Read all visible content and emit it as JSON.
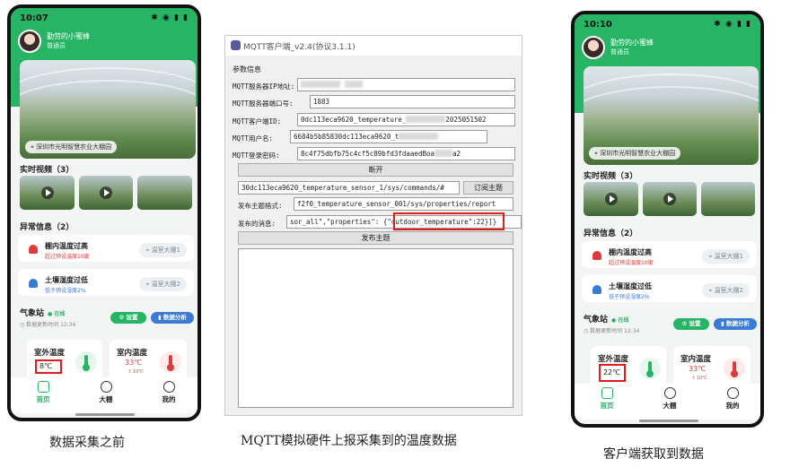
{
  "left_phone": {
    "status": {
      "time": "10:07"
    },
    "user": {
      "name": "勤劳的小蜜蜂",
      "role": "普通员"
    },
    "location": "深圳市光明智慧农业大棚园",
    "realtime_video": {
      "title": "实时视频（3）"
    },
    "alerts": {
      "title": "异常信息（2）",
      "items": [
        {
          "title": "棚内温度过高",
          "detail": "超过预设温度10度",
          "place": "温室大棚1"
        },
        {
          "title": "土壤湿度过低",
          "detail": "低于预设湿度2%",
          "place": "温室大棚2"
        }
      ]
    },
    "weather": {
      "title": "气象站",
      "online": "在线",
      "updated": "数据更新时间  12:34",
      "settings_btn": "设置",
      "analysis_btn": "数据分析"
    },
    "outdoor": {
      "label": "室外温度",
      "value": "8℃"
    },
    "indoor": {
      "label": "室内温度",
      "value": "33℃",
      "delta": "↑ 10℃"
    },
    "nav": [
      "首页",
      "大棚",
      "我的"
    ]
  },
  "right_phone": {
    "status": {
      "time": "10:10"
    },
    "user": {
      "name": "勤劳的小蜜蜂",
      "role": "普通员"
    },
    "location": "深圳市光明智慧农业大棚园",
    "realtime_video": {
      "title": "实时视频（3）"
    },
    "alerts": {
      "title": "异常信息（2）",
      "items": [
        {
          "title": "棚内温度过高",
          "detail": "超过预设温度10度",
          "place": "温室大棚1"
        },
        {
          "title": "土壤湿度过低",
          "detail": "低于预设湿度2%",
          "place": "温室大棚2"
        }
      ]
    },
    "weather": {
      "title": "气象站",
      "online": "在线",
      "updated": "数据更新时间  12:34",
      "settings_btn": "设置",
      "analysis_btn": "数据分析"
    },
    "outdoor": {
      "label": "室外温度",
      "value": "22℃"
    },
    "indoor": {
      "label": "室内温度",
      "value": "33℃",
      "delta": "↑ 10℃"
    },
    "nav": [
      "首页",
      "大棚",
      "我的"
    ]
  },
  "mqtt": {
    "title": "MQTT客户端_v2.4(协议3.1.1)",
    "group": "参数信息",
    "ip_label": "MQTT服务器IP地址:",
    "port_label": "MQTT服务器端口号:",
    "port_value": "1883",
    "client_label": "MQTT客户端ID:",
    "client_value_a": "0dc113eca9620_temperature_",
    "client_value_b": "2025051502",
    "user_label": "MQTT用户名:",
    "user_value_a": "6684b5b85830dc113eca9620_t",
    "pass_label": "MQTT登录密码:",
    "pass_value_a": "8c4f75dbfb75c4cf5c89bfd3fdaaedBoa",
    "pass_value_b": "a2",
    "disconnect_btn": "断开",
    "subscribe_topic": "30dc113eca9620_temperature_sensor_1/sys/commands/#",
    "subscribe_btn": "订阅主题",
    "publish_topic_label": "发布主题格式:",
    "publish_topic_value": "f2f0_temperature_sensor_001/sys/properties/report",
    "message_label": "发布的消息:",
    "message_value_a": "sor_all\",\"properties\": ",
    "message_value_b": "{\"outdoor_temperature\":22}",
    "message_value_c": "]}",
    "publish_btn": "发布主题"
  },
  "captions": {
    "left": "数据采集之前",
    "middle": "MQTT模拟硬件上报采集到的温度数据",
    "right": "客户端获取到数据"
  },
  "colors": {
    "brand_green": "#27b565",
    "highlight_red": "#e21b1b",
    "alert_red": "#e03a3a"
  }
}
